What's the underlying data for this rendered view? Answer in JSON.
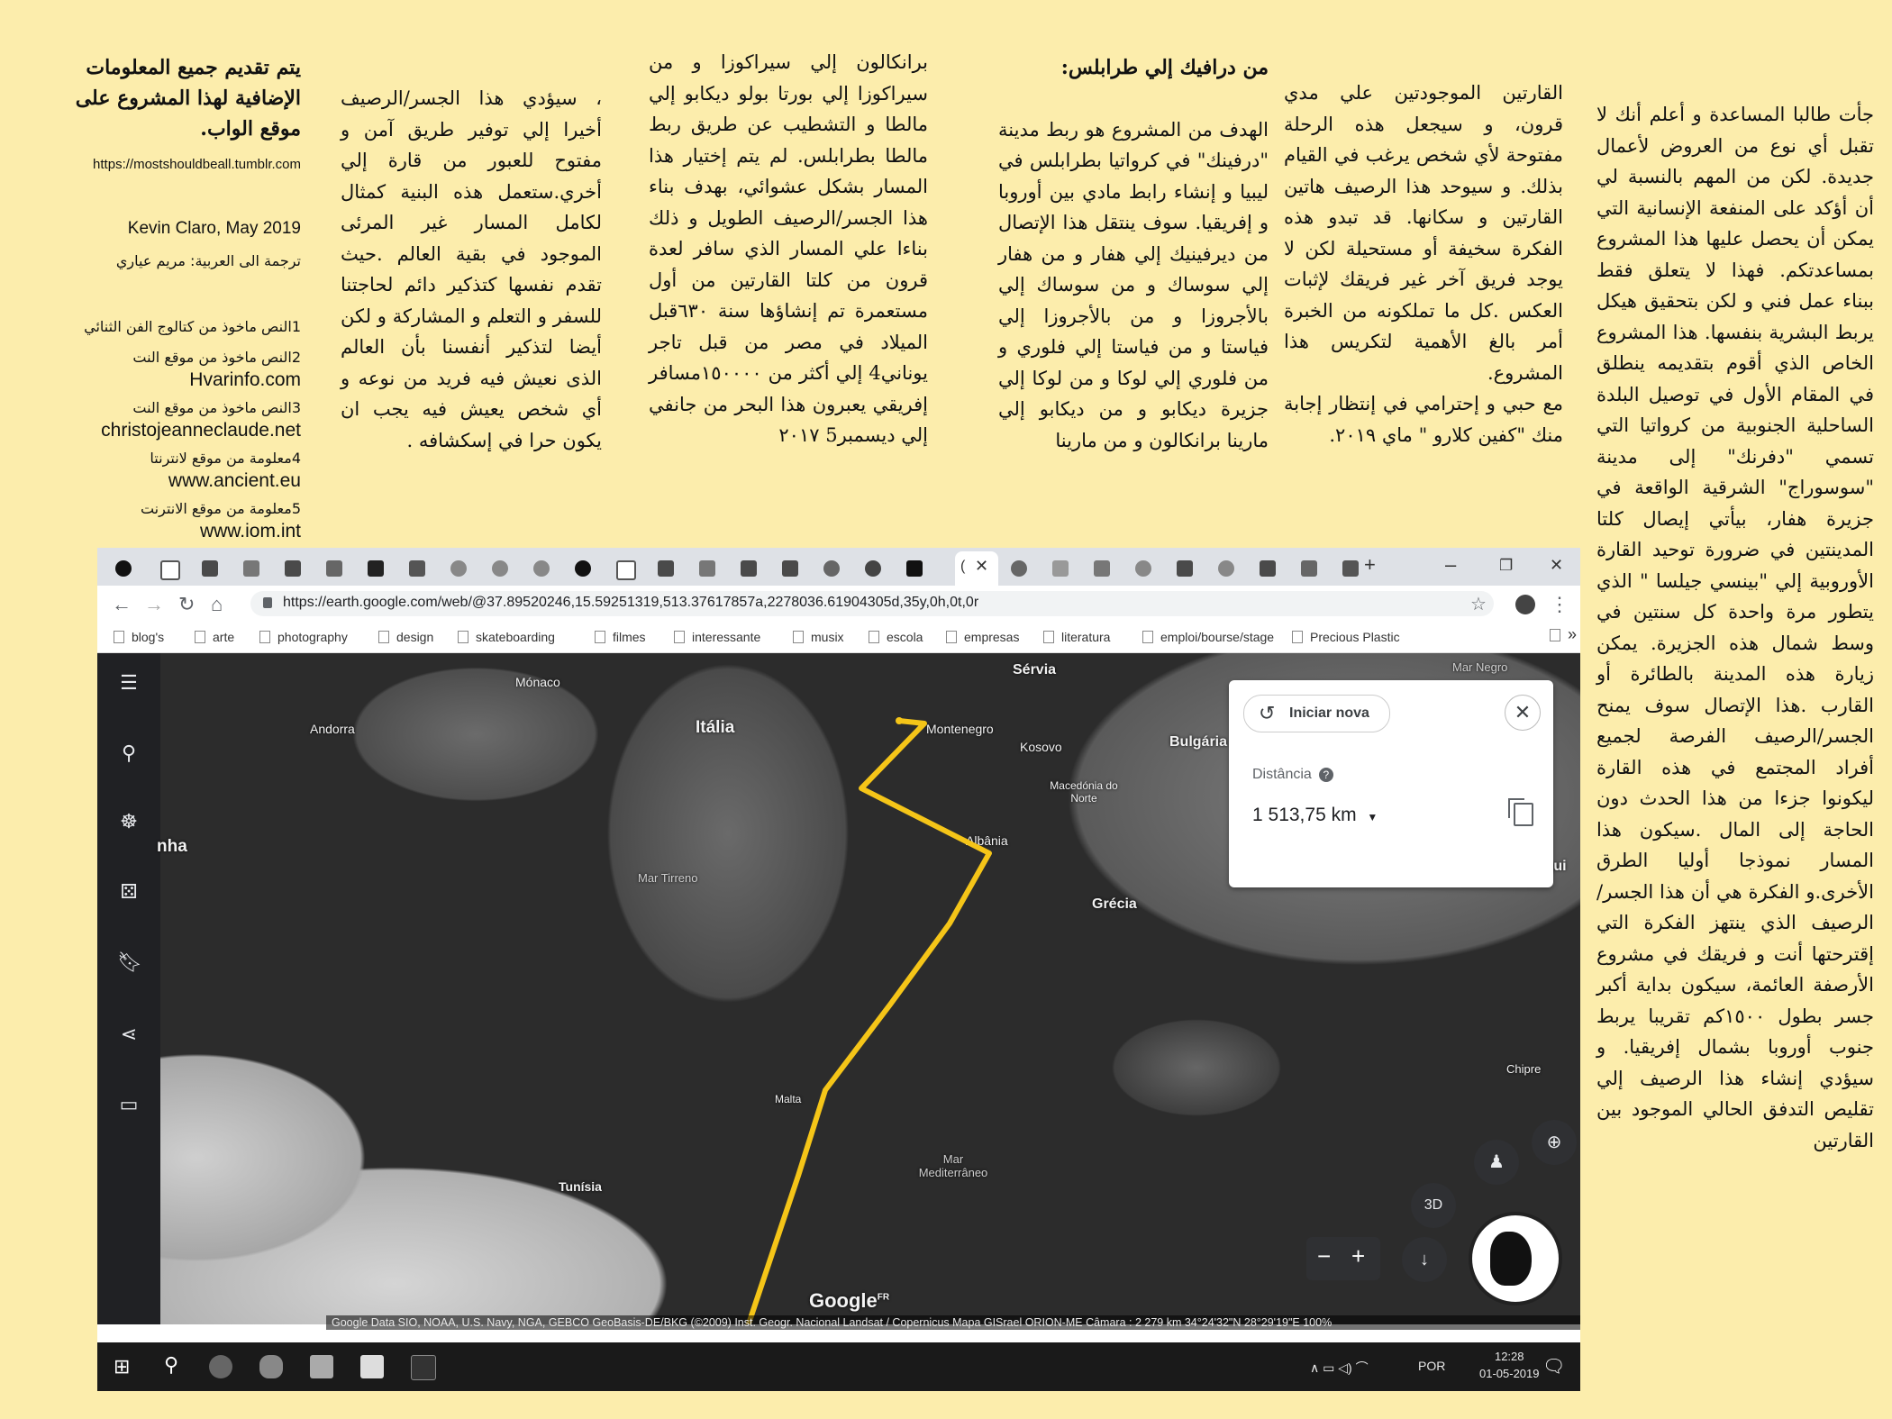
{
  "columns": {
    "col1": "جأت طالبا المساعدة و أعلم أنك لا تقبل أي نوع من العروض لأعمال جديدة. لكن من المهم بالنسبة لي أن أؤكد على المنفعة الإنسانية التي يمكن أن يحصل عليها هذا المشروع بمساعدتكم. فهذا لا يتعلق فقط ببناء عمل فني و لكن بتحقيق هيكل يربط البشرية بنفسها. هذا المشروع الخاص الذي أقوم بتقديمه ينطلق في المقام الأول في توصيل البلدة الساحلية الجنوبية من كرواتيا التي تسمي \"دفرنك\" إلى مدينة \"سوسوراج\" الشرقية الواقعة في جزيرة هفار، بيأتي إيصال كلتا المدينتين في ضرورة توحيد القارة الأوروبية إلي \"بينسي جيلسا \" الذي يتطور مرة واحدة كل سنتين في وسط شمال هذه الجزيرة. يمكن زيارة هذه المدينة بالطائرة أو القارب .هذا الإتصال سوف يمنح الجسر/الرصيف الفرصة لجميع أفراد المجتمع في هذه القارة ليكونوا جزءا من هذا الحدث دون الحاجة إلى المال .سيكون هذا المسار نموذجا أوليا الطرق الأخرى.و الفكرة هي أن هذا الجسر/الرصيف الذي ينتهز الفكرة التي إقترحتها أنت و فريقك في مشروع الأرصفة العائمة، سيكون بداية أكبر جسر بطول ١٥٠٠كم تقريبا يربط جنوب أوروبا بشمال إفريقيا. و سيؤدي إنشاء هذا الرصيف إلي تقليص التدفق الحالي الموجود بين القارتين",
    "col2_p1": "القارتين الموجودتين علي مدي قرون، و سيجعل هذه الرحلة مفتوحة لأي شخص يرغب في القيام بذلك. و سيوحد هذا الرصيف هاتين القارتين و سكانها. قد تبدو هذه الفكرة سخيفة أو مستحيلة لكن لا يوجد فريق آخر غير فريقك لإثبات العكس .كل ما تملكونه من الخبرة أمر بالغ الأهمية لتكريس هذا المشروع.",
    "col2_p2": "مع حبي و إحترامي في إنتظار إجابة منك \"كفين كلارو \" ماي ٢٠١٩.",
    "col3_heading": "من درافيك إلي طرابلس:",
    "col3_body": "الهدف من المشروع هو ربط مدينة \"درفينك\" في كرواتيا بطرابلس في ليبيا و إنشاء رابط مادي بين أوروبا و إفريقيا. سوف ينتقل هذا الإتصال من ديرفينيك إلي هفار و من هفار إلي سوساك و من سوساك إلي بالأجروزا و من بالأجروزا إلي فياستا و من فياستا إلي فلوري و من فلوري إلي لوكا و من لوكا إلي جزيرة ديكابو و من ديكابو إلي مارينا برانكالون و من مارينا",
    "col4": "برانكالون إلي سيراكوزا و من سيراكوزا إلي بورتا بولو ديكابو إلي مالطا و التشطيب عن طريق ربط مالطا بطرابلس. لم يتم إختيار هذا المسار بشكل عشوائي، بهدف بناء هذا الجسر/الرصيف الطويل و ذلك بناءا علي المسار الذي سافر لعدة قرون من كلتا القارتين من أول مستعمرة تم إنشاؤها سنة ٦٣٠قبل الميلاد في مصر من قبل تاجر يوناني4 إلي أكثر من ١٥٠٠٠٠مسافر إفريقي يعبرون هذا البحر من جانفي إلي ديسمبر5 ٢٠١٧",
    "col5": "، سيؤدي هذا الجسر/الرصيف أخيرا إلي توفير طريق آمن و مفتوح للعبور من قارة إلي أخري.ستعمل هذه البنية كمثال لكامل المسار غير المرئى الموجود في بقية العالم .حيث تقدم نفسها كتذكير دائم لحاجتنا للسفر و التعلم و المشاركة و لكن أيضا لتذكير أنفسنا بأن العالم الذى نعيش فيه فريد من نوعه و أي شخص يعيش فيه يجب ان يكون حرا في إسكشافه .",
    "col6_lead": "يتم تقديم جميع المعلومات الإضافية لهذا المشروع على موقع الواب.",
    "col6_url": "https://mostshouldbeall.tumblr.com",
    "col6_author": "Kevin Claro, May 2019",
    "col6_translator": "ترجمة الى العربية: مريم عياري",
    "notes": [
      {
        "label": "1النص ماخوذ من كتالوج الفن الثنائي",
        "link": ""
      },
      {
        "label": "2النص ماخوذ من موقع النت",
        "link": "Hvarinfo.com"
      },
      {
        "label": "3النص ماخوذ من موقع النت",
        "link": "christojeanneclaude.net"
      },
      {
        "label": "4معلومة من موقع لانترنتا",
        "link": "www.ancient.eu"
      },
      {
        "label": "5معلومة من موقع الانترنت",
        "link": "www.iom.int"
      }
    ]
  },
  "browser": {
    "url": "https://earth.google.com/web/@37.89520246,15.59251319,513.37617857a,2278036.61904305d,35y,0h,0t,0r",
    "bookmarks": [
      "blog's",
      "arte",
      "photography",
      "design",
      "skateboarding",
      "filmes",
      "interessante",
      "musix",
      "escola",
      "empresas",
      "literatura",
      "emploi/bourse/stage",
      "Precious Plastic"
    ],
    "window_controls": {
      "minimize": "–",
      "restore": "❐",
      "close": "✕"
    },
    "new_tab": "+"
  },
  "map": {
    "labels": {
      "italia": "Itália",
      "monaco": "Mónaco",
      "andorra": "Andorra",
      "servia": "Sérvia",
      "montenegro": "Montenegro",
      "kosovo": "Kosovo",
      "bulgaria": "Bulgária",
      "macedonia": "Macedónia do Norte",
      "albania": "Albânia",
      "grecia": "Grécia",
      "turquia": "Turqui",
      "mar_negro": "Mar Negro",
      "mar_tirreno": "Mar Tirreno",
      "malta": "Malta",
      "tunisia": "Tunísia",
      "mar_medit": "Mar Mediterrâneo",
      "chipre": "Chipre",
      "spain_cut": "nha"
    },
    "measure": {
      "button": "Iniciar nova",
      "distance_label": "Distância",
      "help": "?",
      "distance_value": "1 513,75 km",
      "close": "✕"
    },
    "btn_3d": "3D",
    "zoom_minus": "−",
    "zoom_plus": "+",
    "google": "Google",
    "google_sup": "FR",
    "attribution": "Google Data SIO, NOAA, U.S. Navy, NGA, GEBCO GeoBasis-DE/BKG (©2009) Inst. Geogr. Nacional Landsat / Copernicus Mapa GISrael ORION-ME   Câmara : 2 279 km   34°24'32\"N 28°29'19\"E  100%",
    "route_color": "#f5c518"
  },
  "taskbar": {
    "lang": "POR",
    "time": "12:28",
    "date": "01-05-2019",
    "tray": "∧ ▭ ◁) ⌒"
  }
}
